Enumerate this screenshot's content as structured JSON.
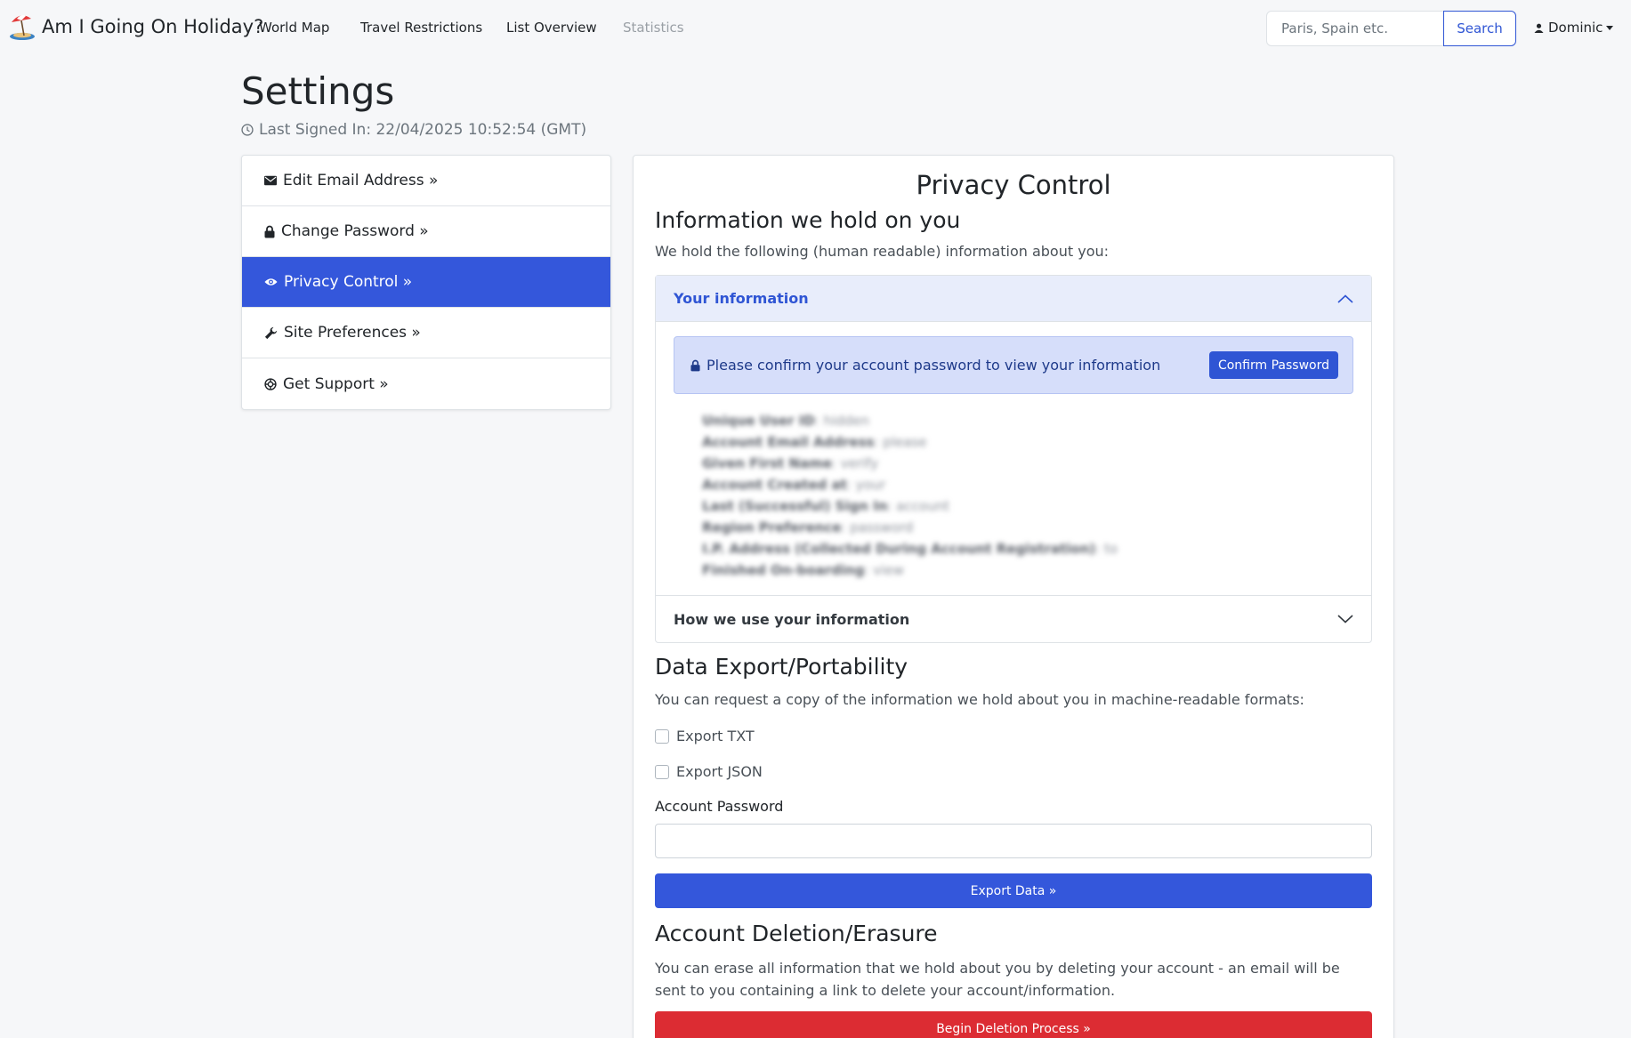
{
  "navbar": {
    "brand": "Am I Going On Holiday?",
    "links": [
      {
        "label": "World Map"
      },
      {
        "label": "Travel Restrictions"
      },
      {
        "label": "List Overview"
      },
      {
        "label": "Statistics",
        "disabled": true
      }
    ],
    "search_placeholder": "Paris, Spain etc.",
    "search_button": "Search",
    "user_name": "Dominic"
  },
  "header": {
    "title": "Settings",
    "last_signed_in": "Last Signed In: 22/04/2025 10:52:54 (GMT)"
  },
  "sidebar": {
    "items": [
      {
        "label": "Edit Email Address »",
        "icon": "envelope-icon"
      },
      {
        "label": "Change Password »",
        "icon": "lock-icon"
      },
      {
        "label": "Privacy Control »",
        "icon": "eye-icon",
        "active": true
      },
      {
        "label": "Site Preferences »",
        "icon": "wrench-icon"
      },
      {
        "label": "Get Support »",
        "icon": "lifebuoy-icon"
      }
    ]
  },
  "privacy": {
    "title": "Privacy Control",
    "info_heading": "Information we hold on you",
    "info_text": "We hold the following (human readable) information about you:",
    "accordion": {
      "your_info_title": "Your information",
      "alert_text": "Please confirm your account password to view your information",
      "confirm_button": "Confirm Password",
      "blurred_items": [
        {
          "label": "Unique User ID",
          "value": "hidden"
        },
        {
          "label": "Account Email Address",
          "value": "please"
        },
        {
          "label": "Given First Name",
          "value": "verify"
        },
        {
          "label": "Account Created at",
          "value": "your"
        },
        {
          "label": "Last (Successful) Sign In",
          "value": "account"
        },
        {
          "label": "Region Preference",
          "value": "password"
        },
        {
          "label": "I.P. Address (Collected During Account Registration)",
          "value": "to"
        },
        {
          "label": "Finished On-boarding",
          "value": "view"
        }
      ],
      "how_use_title": "How we use your information"
    },
    "export_heading": "Data Export/Portability",
    "export_text": "You can request a copy of the information we hold about you in machine-readable formats:",
    "export_txt": "Export TXT",
    "export_json": "Export JSON",
    "password_label": "Account Password",
    "export_button": "Export Data »",
    "delete_heading": "Account Deletion/Erasure",
    "delete_text": "You can erase all information that we hold about you by deleting your account - an email will be sent to you containing a link to delete your account/information.",
    "delete_button": "Begin Deletion Process »"
  },
  "colors": {
    "primary": "#3457db",
    "danger": "#dc2c33",
    "accordion_open_bg": "#e8edfb",
    "alert_bg": "#d6defa"
  }
}
